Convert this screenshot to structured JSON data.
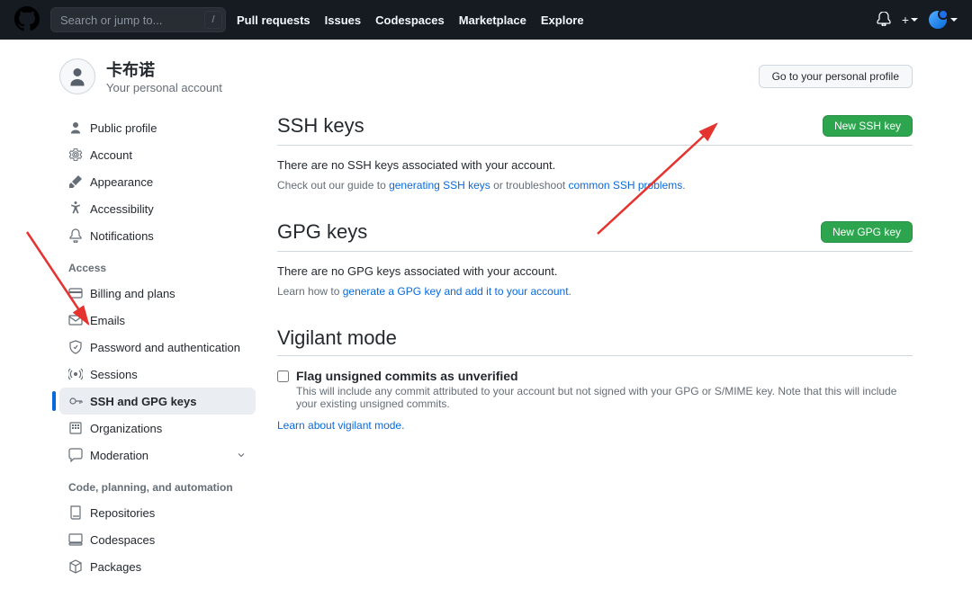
{
  "header": {
    "search_placeholder": "Search or jump to...",
    "slash": "/",
    "nav": [
      "Pull requests",
      "Issues",
      "Codespaces",
      "Marketplace",
      "Explore"
    ],
    "plus": "+"
  },
  "profile": {
    "name": "卡布诺",
    "subtitle": "Your personal account",
    "button": "Go to your personal profile"
  },
  "sidebar": {
    "group1": [
      {
        "icon": "person",
        "label": "Public profile"
      },
      {
        "icon": "gear",
        "label": "Account"
      },
      {
        "icon": "paintbrush",
        "label": "Appearance"
      },
      {
        "icon": "accessibility",
        "label": "Accessibility"
      },
      {
        "icon": "bell",
        "label": "Notifications"
      }
    ],
    "access_title": "Access",
    "group2": [
      {
        "icon": "credit",
        "label": "Billing and plans"
      },
      {
        "icon": "mail",
        "label": "Emails"
      },
      {
        "icon": "shield",
        "label": "Password and authentication"
      },
      {
        "icon": "broadcast",
        "label": "Sessions"
      },
      {
        "icon": "key",
        "label": "SSH and GPG keys",
        "active": true
      },
      {
        "icon": "org",
        "label": "Organizations"
      },
      {
        "icon": "comment",
        "label": "Moderation",
        "caret": true
      }
    ],
    "code_title": "Code, planning, and automation",
    "group3": [
      {
        "icon": "repo",
        "label": "Repositories"
      },
      {
        "icon": "codespaces",
        "label": "Codespaces"
      },
      {
        "icon": "package",
        "label": "Packages"
      }
    ]
  },
  "main": {
    "ssh": {
      "heading": "SSH keys",
      "button": "New SSH key",
      "empty": "There are no SSH keys associated with your account.",
      "guide_pre": "Check out our guide to ",
      "guide_link1": "generating SSH keys",
      "guide_mid": " or troubleshoot ",
      "guide_link2": "common SSH problems",
      "guide_post": "."
    },
    "gpg": {
      "heading": "GPG keys",
      "button": "New GPG key",
      "empty": "There are no GPG keys associated with your account.",
      "learn_pre": "Learn how to ",
      "learn_link": "generate a GPG key and add it to your account",
      "learn_post": "."
    },
    "vigilant": {
      "heading": "Vigilant mode",
      "checkbox_label": "Flag unsigned commits as unverified",
      "desc": "This will include any commit attributed to your account but not signed with your GPG or S/MIME key. Note that this will include your existing unsigned commits.",
      "learn": "Learn about vigilant mode."
    }
  }
}
